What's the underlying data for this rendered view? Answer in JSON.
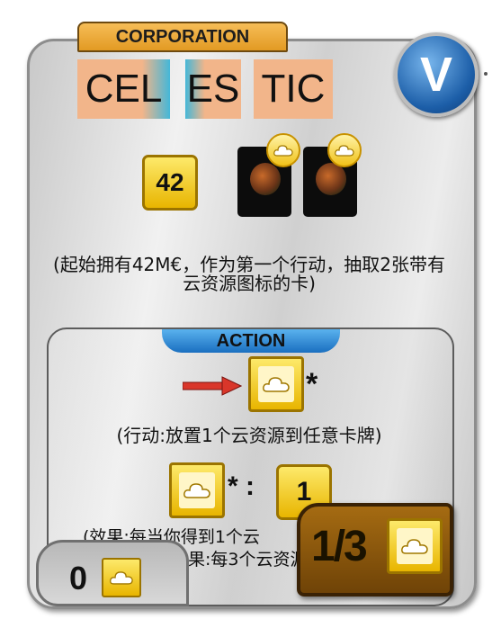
{
  "card": {
    "tag": "CORPORATION",
    "name_parts": [
      "CEL",
      "ES",
      "TIC"
    ],
    "version_badge": "V",
    "starting_megacredits": "42",
    "description": "(起始拥有42M€，作为第一个行动，抽取2张带有云资源图标的卡)"
  },
  "action": {
    "tag": "ACTION",
    "asterisk": "*",
    "description": "(行动:放置1个云资源到任意卡牌)"
  },
  "effect": {
    "asterisk_colon": "* :",
    "megacredit_value": "1",
    "description_partial": "(效果:每当你得到1个云",
    "description_partial_2": "效果:每3个云资源"
  },
  "victory_points": "1/3",
  "resources": {
    "count": "0"
  },
  "colors": {
    "tag": "#e9a634",
    "name_bg": "#f2b58a",
    "name_accent": "#44b7d8",
    "action_tag": "#2a86d6",
    "megacredit": "#f5cd2b",
    "vp_box": "#8c5a10"
  },
  "icons": [
    "cloud-icon",
    "megacredit-icon",
    "red-arrow-icon",
    "planet-card-icon"
  ]
}
